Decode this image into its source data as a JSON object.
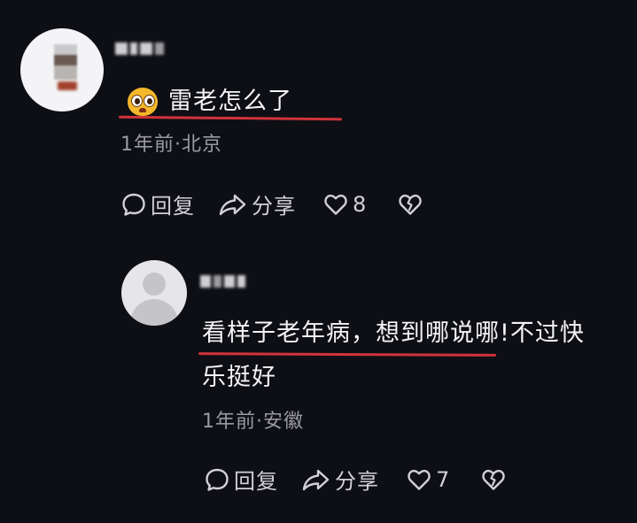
{
  "comments": [
    {
      "username": "",
      "emoji": "anxious-face-emoji",
      "text": "雷老怎么了",
      "meta": "1年前·北京",
      "actions": {
        "reply": "回复",
        "share": "分享",
        "likes": "8"
      }
    },
    {
      "username": "",
      "text_line1": "看样子老年病，想到哪说哪!不过快",
      "text_line2": "乐挺好",
      "meta": "1年前·安徽",
      "actions": {
        "reply": "回复",
        "share": "分享",
        "likes": "7"
      }
    }
  ],
  "colors": {
    "background": "#0e0f14",
    "underline": "#d0333a",
    "meta_text": "#9a9aa2"
  }
}
